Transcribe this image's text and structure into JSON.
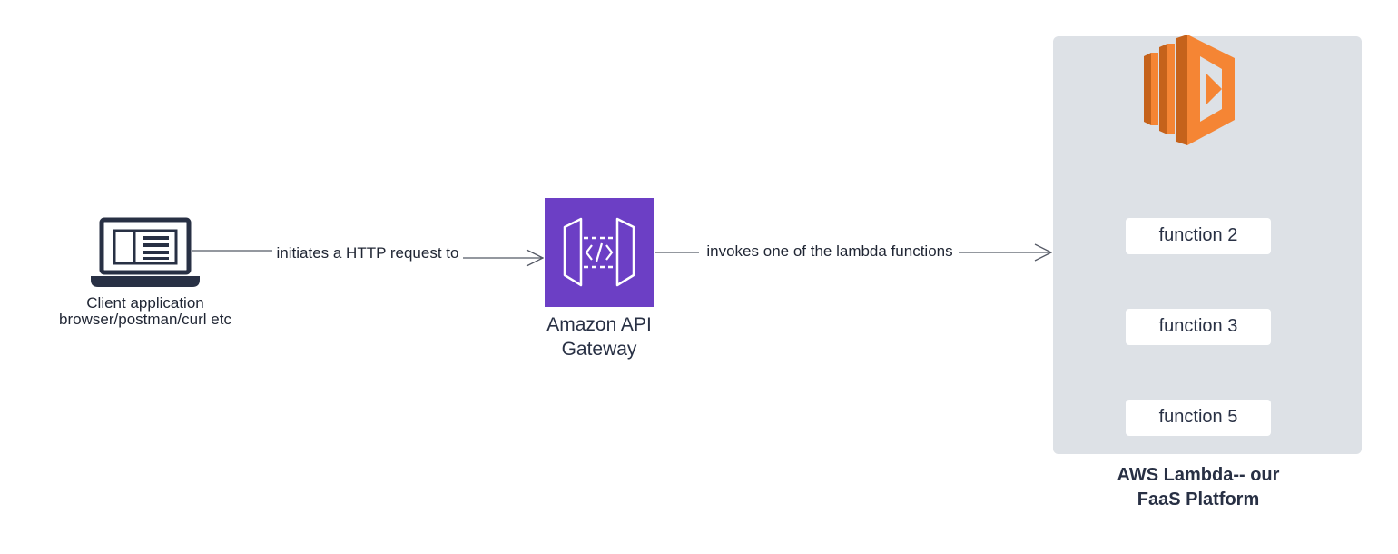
{
  "client": {
    "label_line1": "Client application",
    "label_line2": "browser/postman/curl etc",
    "icon": "laptop-icon"
  },
  "edge_request": {
    "label": "initiates a HTTP request to"
  },
  "gateway": {
    "label_line1": "Amazon API",
    "label_line2": "Gateway",
    "icon": "api-gateway-icon",
    "color": "#6C3FC5"
  },
  "edge_invoke": {
    "label": "invokes one of the lambda functions"
  },
  "lambda_platform": {
    "title_line1": "AWS Lambda-- our",
    "title_line2": "FaaS Platform",
    "icon": "aws-lambda-icon",
    "panel_color": "#DDE1E6",
    "icon_color": "#F58534",
    "functions": [
      {
        "label": "function 2"
      },
      {
        "label": "function 3"
      },
      {
        "label": "function 5"
      }
    ]
  }
}
